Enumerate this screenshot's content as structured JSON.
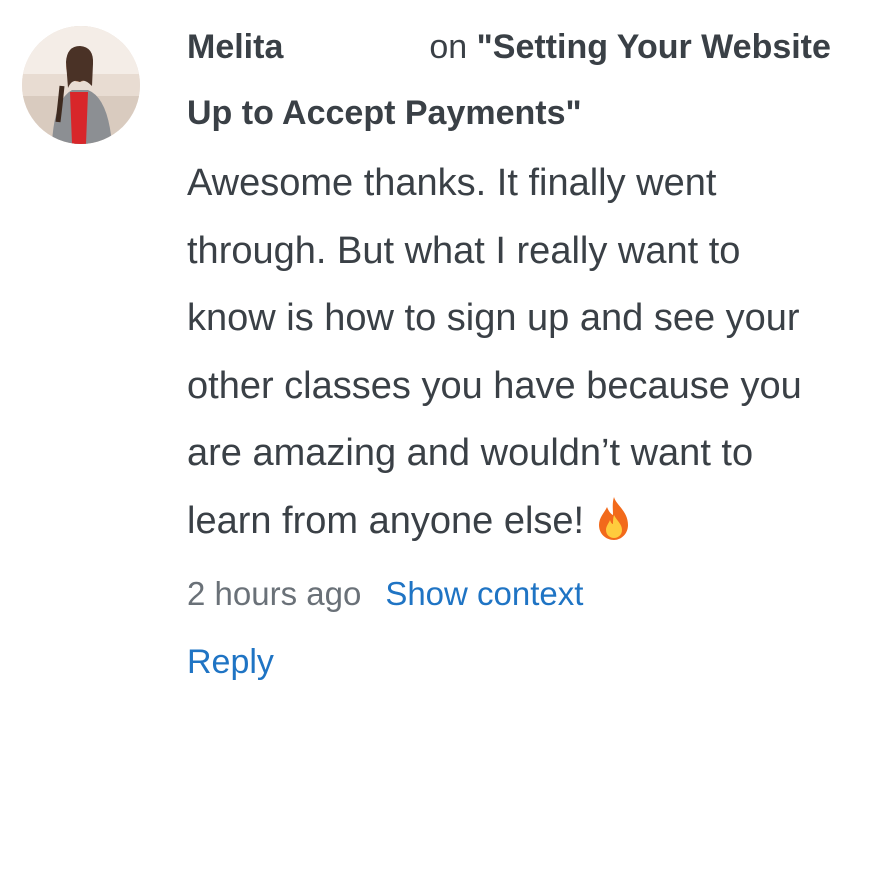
{
  "comment": {
    "author": "Melita",
    "on_word": "on",
    "post_title": "\"Setting Your Website Up to Accept Payments\"",
    "body": "Awesome thanks. It finally went through. But what I really want to know is how to sign up and see your other classes you have because you are amazing and wouldn’t want to learn from anyone else!",
    "emoji_icon": "fire-icon",
    "timestamp": "2 hours ago",
    "show_context_label": "Show context",
    "reply_label": "Reply"
  },
  "colors": {
    "text": "#3a4046",
    "muted": "#6a7178",
    "link": "#1f74c4",
    "fire_outer": "#f26a1b",
    "fire_inner": "#ffcc3d"
  }
}
